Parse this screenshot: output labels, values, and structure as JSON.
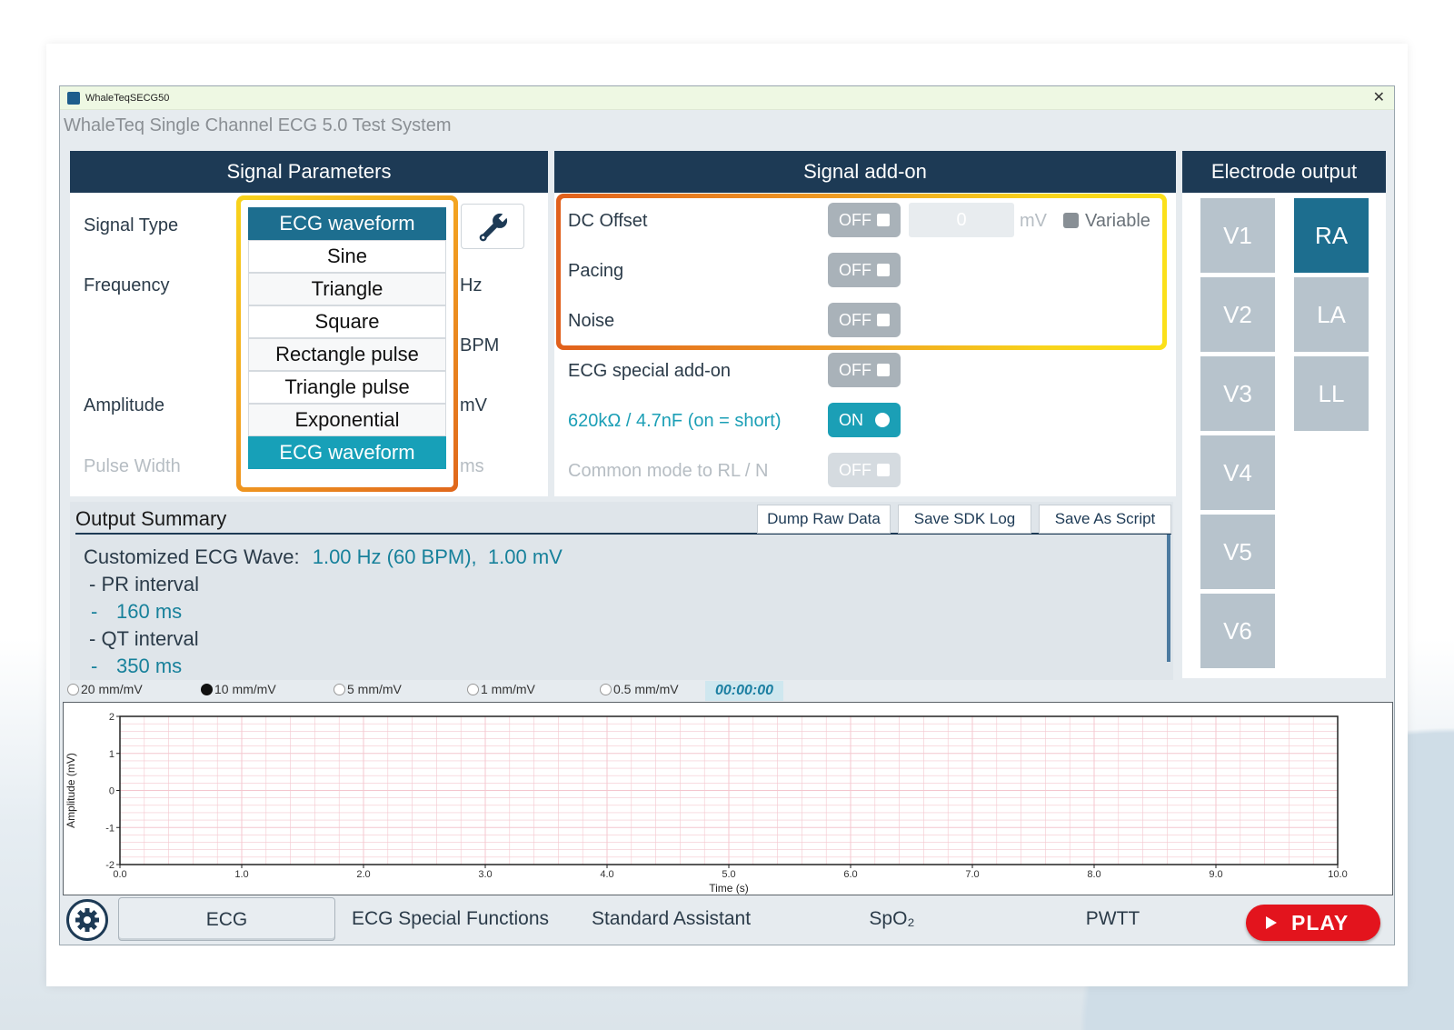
{
  "window": {
    "title": "WhaleTeqSECG50",
    "subtitle": "WhaleTeq Single Channel ECG 5.0 Test System",
    "close": "✕"
  },
  "signal_params": {
    "title": "Signal Parameters",
    "labels": {
      "signal_type": "Signal Type",
      "frequency": "Frequency",
      "amplitude": "Amplitude",
      "pulse_width": "Pulse Width"
    },
    "units": {
      "hz": "Hz",
      "bpm": "BPM",
      "mv": "mV",
      "ms": "ms"
    },
    "dropdown": {
      "selected": "ECG waveform",
      "options": [
        "Sine",
        "Triangle",
        "Square",
        "Rectangle pulse",
        "Triangle pulse",
        "Exponential",
        "ECG waveform"
      ]
    },
    "settings_icon": "wrench-icon"
  },
  "signal_addon": {
    "title": "Signal add-on",
    "dc_offset": {
      "label": "DC Offset",
      "state": "OFF",
      "value": "0",
      "unit": "mV",
      "variable_label": "Variable"
    },
    "pacing": {
      "label": "Pacing",
      "state": "OFF"
    },
    "noise": {
      "label": "Noise",
      "state": "OFF"
    },
    "ecg_special": {
      "label": "ECG special add-on",
      "state": "OFF"
    },
    "impedance": {
      "label": "620kΩ / 4.7nF (on = short)",
      "state": "ON"
    },
    "common_mode": {
      "label": "Common mode to RL / N",
      "state": "OFF"
    }
  },
  "electrode_output": {
    "title": "Electrode output",
    "chest": [
      "V1",
      "V2",
      "V3",
      "V4",
      "V5",
      "V6"
    ],
    "limb": [
      "RA",
      "LA",
      "LL"
    ],
    "active": "RA"
  },
  "output_summary": {
    "title": "Output Summary",
    "buttons": {
      "dump": "Dump Raw Data",
      "sdk_log": "Save SDK Log",
      "script": "Save As Script"
    },
    "wave_label": "Customized ECG Wave:",
    "wave_value": "1.00 Hz (60 BPM),  1.00 mV",
    "pr_label": "- PR interval",
    "pr_value": "160 ms",
    "qt_label": "- QT interval",
    "qt_value": "350 ms",
    "dash": "-"
  },
  "scale": {
    "options": [
      "20 mm/mV",
      "10 mm/mV",
      "5 mm/mV",
      "1 mm/mV",
      "0.5 mm/mV"
    ],
    "selected": "10 mm/mV",
    "timer": "00:00:00"
  },
  "chart_data": {
    "type": "line",
    "title": "",
    "xlabel": "Time (s)",
    "ylabel": "Amplitude (mV)",
    "xlim": [
      0.0,
      10.0
    ],
    "ylim": [
      -2,
      2
    ],
    "x_ticks": [
      "0.0",
      "1.0",
      "2.0",
      "3.0",
      "4.0",
      "5.0",
      "6.0",
      "7.0",
      "8.0",
      "9.0",
      "10.0"
    ],
    "y_ticks": [
      "2",
      "1",
      "0",
      "-1",
      "-2"
    ],
    "grid": true,
    "grid_color": "#f4c7cf",
    "series": []
  },
  "tabs": {
    "settings_icon": "gear-icon",
    "items": [
      "ECG",
      "ECG Special Functions",
      "Standard Assistant",
      "SpO₂",
      "PWTT"
    ],
    "active": "ECG",
    "play": "PLAY"
  }
}
